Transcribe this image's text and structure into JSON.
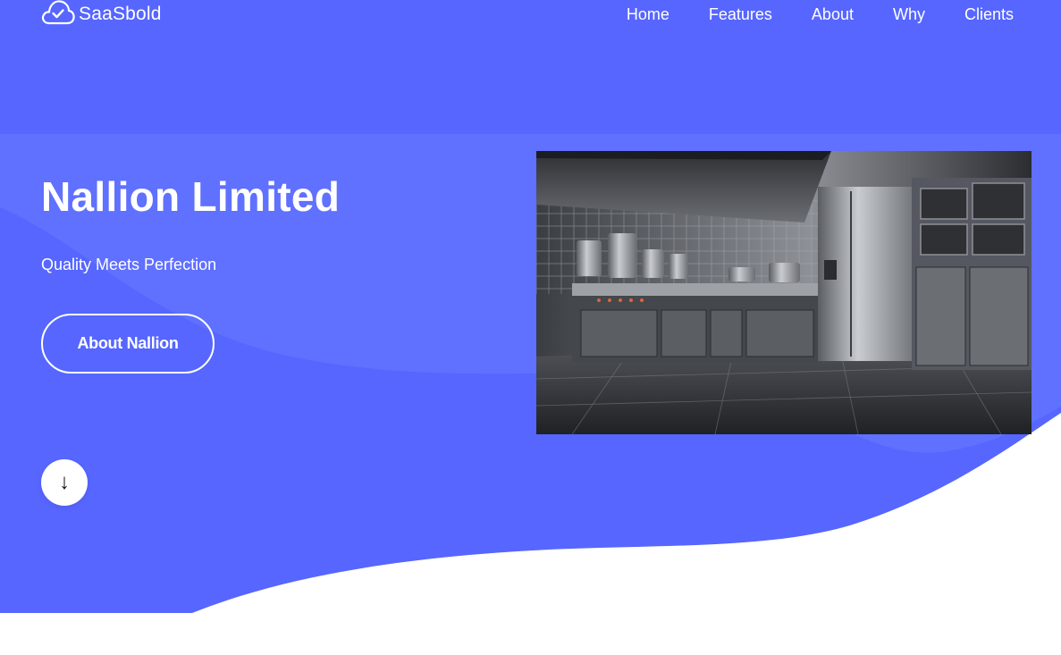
{
  "colors": {
    "primary_bg": "#5666ff",
    "wave_light": "#6a78ff",
    "nav_underline": "#f4c14a",
    "text": "#ffffff"
  },
  "brand": {
    "name": "SaaSbold",
    "icon": "cloud-check-icon"
  },
  "nav": {
    "items": [
      {
        "label": "Home",
        "active": true
      },
      {
        "label": "Features"
      },
      {
        "label": "About"
      },
      {
        "label": "Why"
      },
      {
        "label": "Clients"
      }
    ]
  },
  "hero": {
    "title": "Nallion Limited",
    "subtitle": "Quality Meets Perfection",
    "cta_label": "About Nallion",
    "scroll_icon": "↓",
    "image_subject": "commercial-kitchen-image"
  }
}
